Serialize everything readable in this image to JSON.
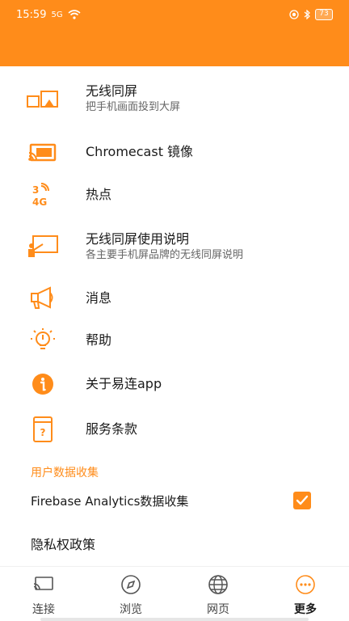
{
  "status_bar": {
    "time": "15:59",
    "signal": "5G",
    "battery": "73"
  },
  "colors": {
    "accent": "#ff8c1a",
    "text_primary": "#1a1a1a",
    "text_secondary": "#666666"
  },
  "menu": [
    {
      "title": "无线同屏",
      "subtitle": "把手机画面投到大屏",
      "icon": "cast-screen-icon"
    },
    {
      "title": "Chromecast 镜像",
      "subtitle": "",
      "icon": "chromecast-icon"
    },
    {
      "title": "热点",
      "subtitle": "",
      "icon": "hotspot-4g-icon"
    },
    {
      "title": "无线同屏使用说明",
      "subtitle": "各主要手机屏品牌的无线同屏说明",
      "icon": "presentation-icon"
    },
    {
      "title": "消息",
      "subtitle": "",
      "icon": "megaphone-icon"
    },
    {
      "title": "帮助",
      "subtitle": "",
      "icon": "lightbulb-icon"
    },
    {
      "title": "关于易连app",
      "subtitle": "",
      "icon": "info-icon"
    },
    {
      "title": "服务条款",
      "subtitle": "",
      "icon": "terms-document-icon"
    }
  ],
  "data_collection": {
    "header": "用户数据收集",
    "firebase_label": "Firebase Analytics数据收集",
    "firebase_checked": true
  },
  "privacy_policy": "隐私权政策",
  "bottom_nav": [
    {
      "label": "连接",
      "icon": "cast-icon",
      "active": false
    },
    {
      "label": "浏览",
      "icon": "compass-icon",
      "active": false
    },
    {
      "label": "网页",
      "icon": "globe-icon",
      "active": false
    },
    {
      "label": "更多",
      "icon": "more-dots-icon",
      "active": true
    }
  ]
}
